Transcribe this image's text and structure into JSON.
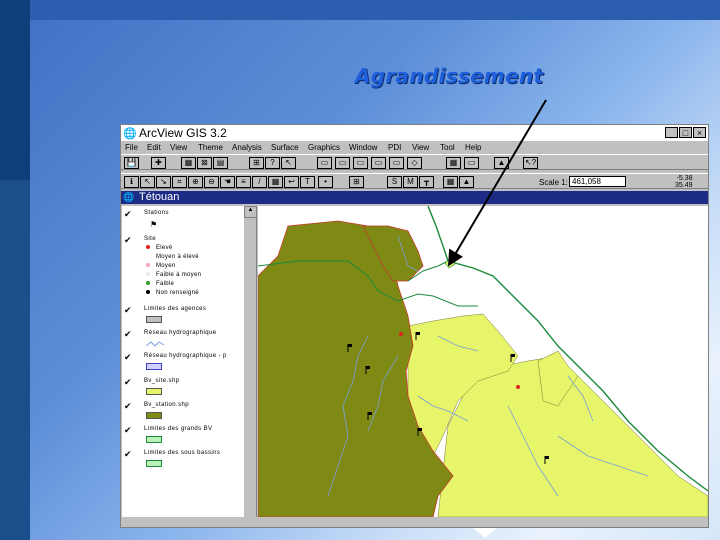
{
  "slide": {
    "title": "Agrandissement",
    "title_color": "#1f5fd9"
  },
  "window": {
    "title": "ArcView GIS 3.2",
    "controls": [
      "_",
      "□",
      "×"
    ]
  },
  "menu": [
    "File",
    "Edit",
    "View",
    "Theme",
    "Analysis",
    "Surface",
    "Graphics",
    "Window",
    "PDI",
    "View",
    "Tool",
    "Help"
  ],
  "toolbar1": [
    "💾",
    "✚",
    "▦",
    "⊠",
    "▤",
    "⊞",
    "?",
    "↖",
    "▭",
    "▭",
    "▭",
    "▭",
    "▭",
    "◇",
    "▦",
    "▭",
    "▲",
    "↖?"
  ],
  "toolbar2": {
    "tools": [
      "ℹ",
      "↖",
      "↘",
      "⌗",
      "⊕",
      "⊖",
      "☚",
      "≡",
      "/",
      "▦",
      "↩",
      "T",
      "•",
      "⊞",
      "S",
      "M",
      "┳",
      "▦",
      "▲"
    ],
    "scale_label": "Scale 1:",
    "scale_value": "461,058",
    "coord_x": "-5.38",
    "coord_y": "35.49"
  },
  "view": {
    "title": "Tétouan"
  },
  "toc": {
    "layers": [
      {
        "name": "Stations",
        "checked": true
      },
      {
        "name": "Site",
        "checked": true
      },
      {
        "name": "Limites des agences",
        "checked": true
      },
      {
        "name": "Réseau hydrographique",
        "checked": true
      },
      {
        "name": "Réseau hydrographique - p",
        "checked": true
      },
      {
        "name": "Bv_site.shp",
        "checked": true
      },
      {
        "name": "Bv_station.shp",
        "checked": true
      },
      {
        "name": "Limites des grands BV",
        "checked": true
      },
      {
        "name": "Limites des sous bassins",
        "checked": true
      }
    ],
    "site_legend": [
      {
        "label": "Elevé",
        "color": "#e02020"
      },
      {
        "label": "Moyen à élevé",
        "color": "#ffffff"
      },
      {
        "label": "Moyen",
        "color": "#f4a0c8"
      },
      {
        "label": "Faible à moyen",
        "color": "#e8e8e8"
      },
      {
        "label": "Faible",
        "color": "#2aa02a"
      },
      {
        "label": "Non renseigné",
        "color": "#000000"
      }
    ],
    "swatch_colors": {
      "limites_agences": "#c0c0c0",
      "reseau_p": "#d0d0ff",
      "bv_site": "#e6f56a",
      "bv_station": "#7f8a14",
      "grands_bv": "#b8f0b8",
      "sous_bassins": "#b8f0b8"
    }
  },
  "map_colors": {
    "station_basin": "#7f8a14",
    "site_basin": "#e6f56a",
    "rivers": "#7a9fd8",
    "boundary": "#1a8a3a",
    "red_line": "#d42020"
  }
}
